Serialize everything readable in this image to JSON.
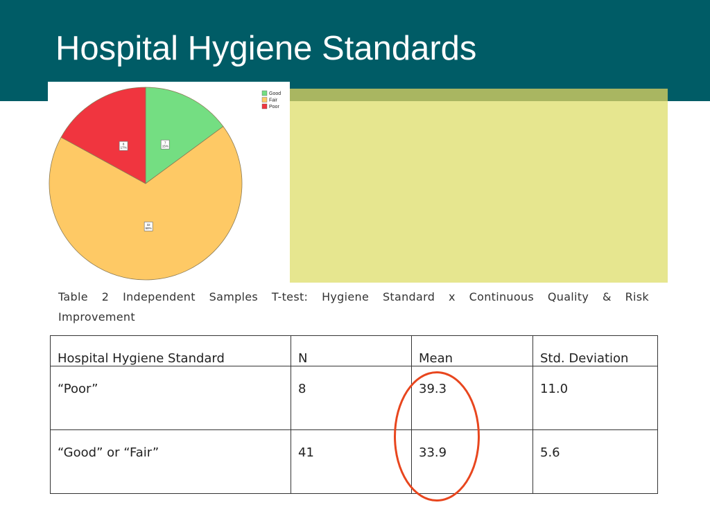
{
  "slide": {
    "title": "Hospital Hygiene Standards",
    "header_color": "#005c66"
  },
  "chart_data": {
    "type": "pie",
    "title": "",
    "legend_position": "top-right",
    "categories": [
      "Good",
      "Fair",
      "Poor"
    ],
    "values": [
      7,
      32,
      8
    ],
    "percent_labels": [
      "7\n15%",
      "32\n68%",
      "8\n17%"
    ],
    "colors": [
      "#74de82",
      "#fec965",
      "#f0353f"
    ],
    "start_angle_deg": 0,
    "direction": "clockwise"
  },
  "table": {
    "caption": "Table 2 Independent Samples T-test: Hygiene Standard x Continuous Quality & Risk Improvement",
    "headers": [
      "Hospital Hygiene Standard",
      "N",
      "Mean",
      "Std. Deviation"
    ],
    "rows": [
      [
        "“Poor”",
        "8",
        "39.3",
        "11.0"
      ],
      [
        "“Good” or “Fair”",
        "41",
        "33.9",
        "5.6"
      ]
    ],
    "highlight_color": "#e8461e"
  }
}
